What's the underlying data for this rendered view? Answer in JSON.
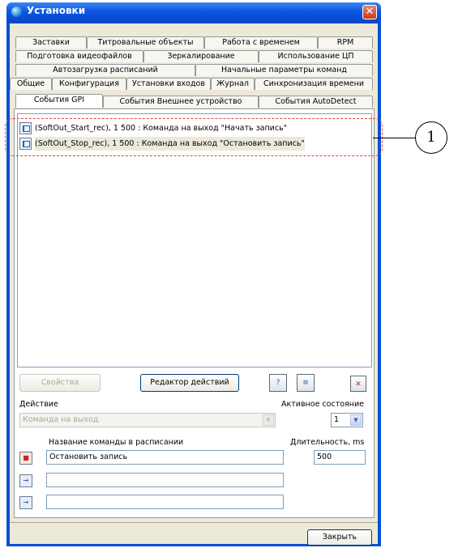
{
  "window": {
    "title": "Установки",
    "close_glyph": "✕"
  },
  "tabs": {
    "row1": [
      "Заставки",
      "Титровальные объекты",
      "Работа с временем",
      "RPM"
    ],
    "row2": [
      "Подготовка видеофайлов",
      "Зеркалирование",
      "Использование ЦП"
    ],
    "row3": [
      "Автозагрузка расписаний",
      "Начальные параметры команд"
    ],
    "row4": [
      "Общие",
      "Конфигурация",
      "Установки входов",
      "Журнал",
      "Синхронизация времени"
    ],
    "row5": [
      "События GPI",
      "События Внешнее устройство",
      "События AutoDetect"
    ],
    "active": "События GPI"
  },
  "events": [
    "(SoftOut_Start_rec), 1 500 : Команда на выход \"Начать запись\"",
    "(SoftOut_Stop_rec), 1 500 : Команда на выход \"Остановить запись\""
  ],
  "buttons": {
    "properties": "Свойства",
    "action_editor": "Редактор действий",
    "close": "Закрыть"
  },
  "action": {
    "label": "Действие",
    "value": "Команда на выход",
    "active_state_label": "Активное состояние",
    "active_state_value": "1"
  },
  "commands": {
    "name_header": "Название команды в расписании",
    "duration_header": "Длительность, ms",
    "rows": [
      {
        "name": "Остановить запись",
        "duration": "500"
      },
      {
        "name": "",
        "duration": ""
      },
      {
        "name": "",
        "duration": ""
      }
    ]
  },
  "callout": {
    "number": "1"
  },
  "icons": {
    "title": "globe-icon",
    "event": "event-icon",
    "toolbar": [
      "edit-event-icon",
      "event-list-icon",
      "delete-icon"
    ],
    "command_rows": [
      "stop-command-icon",
      "command-icon",
      "command-icon"
    ]
  }
}
